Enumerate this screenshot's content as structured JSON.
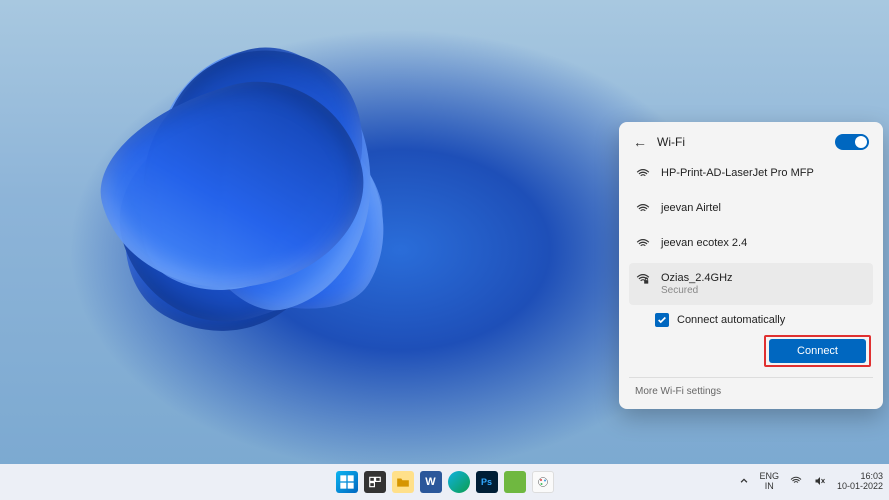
{
  "wifi": {
    "title": "Wi-Fi",
    "toggle_on": true,
    "networks": [
      {
        "name": "HP-Print-AD-LaserJet Pro MFP"
      },
      {
        "name": "jeevan Airtel"
      },
      {
        "name": "jeevan ecotex 2.4"
      }
    ],
    "selected": {
      "name": "Ozias_2.4GHz",
      "subtitle": "Secured",
      "auto_connect_label": "Connect automatically",
      "auto_connect_checked": true,
      "connect_label": "Connect"
    },
    "more_label": "More Wi-Fi settings"
  },
  "taskbar": {
    "apps": [
      {
        "id": "start",
        "name": "start-button"
      },
      {
        "id": "taskview",
        "name": "task-view-button",
        "color": "#555"
      },
      {
        "id": "explorer",
        "name": "file-explorer-button",
        "color": "#f0c060"
      },
      {
        "id": "word",
        "name": "word-button",
        "bg": "#2b579a",
        "glyph": "W"
      },
      {
        "id": "edge",
        "name": "edge-button",
        "bg": "#0c9e8e"
      },
      {
        "id": "photoshop",
        "name": "photoshop-button",
        "bg": "#001e36",
        "glyph": "Ps",
        "fg": "#31a8ff"
      },
      {
        "id": "andy",
        "name": "app-button",
        "bg": "#6fb840"
      },
      {
        "id": "paint",
        "name": "paint-button",
        "bg": "#fafafa"
      }
    ],
    "tray": {
      "lang_top": "ENG",
      "lang_bot": "IN",
      "time": "16:03",
      "date": "10-01-2022"
    }
  }
}
